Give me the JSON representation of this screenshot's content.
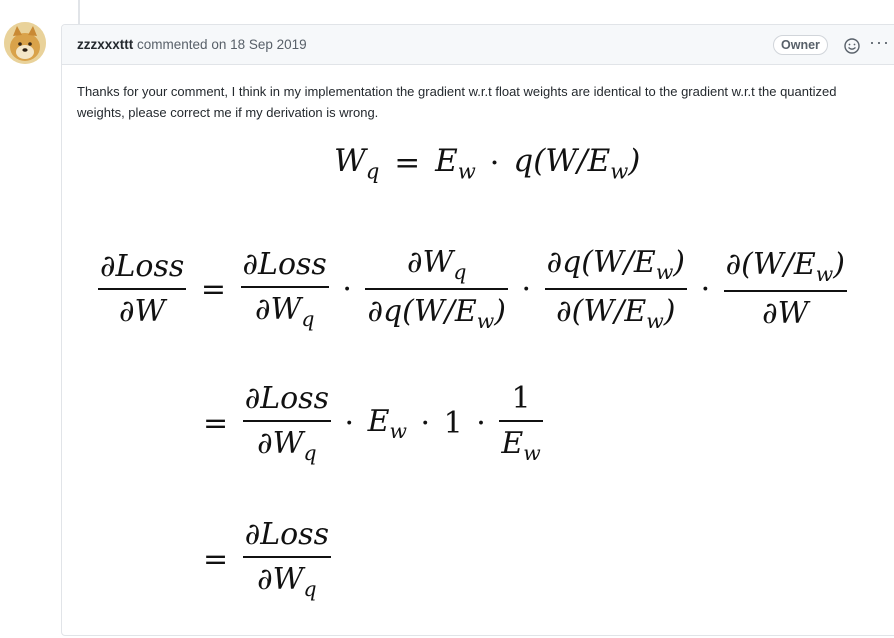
{
  "comment": {
    "author": "zzzxxxttt",
    "action": "commented on",
    "date": "18 Sep 2019",
    "badge": "Owner",
    "more": "···",
    "body": "Thanks for your comment, I think in my implementation the gradient w.r.t float weights are identical to the gradient w.r.t the quantized weights, please correct me if my derivation is wrong."
  },
  "formula": {
    "W": "W",
    "q": "q",
    "E": "E",
    "w": "w",
    "eq": "=",
    "dot": "·",
    "one": "1",
    "dLoss": "∂Loss",
    "dW": "∂W",
    "dWq_partial": "∂W",
    "dq_open": "∂q(W/E",
    "close": ")",
    "d_open": "∂(W/E",
    "q_open": "q(W/E"
  },
  "icons": [
    "avatar",
    "smiley-icon",
    "kebab-icon"
  ]
}
